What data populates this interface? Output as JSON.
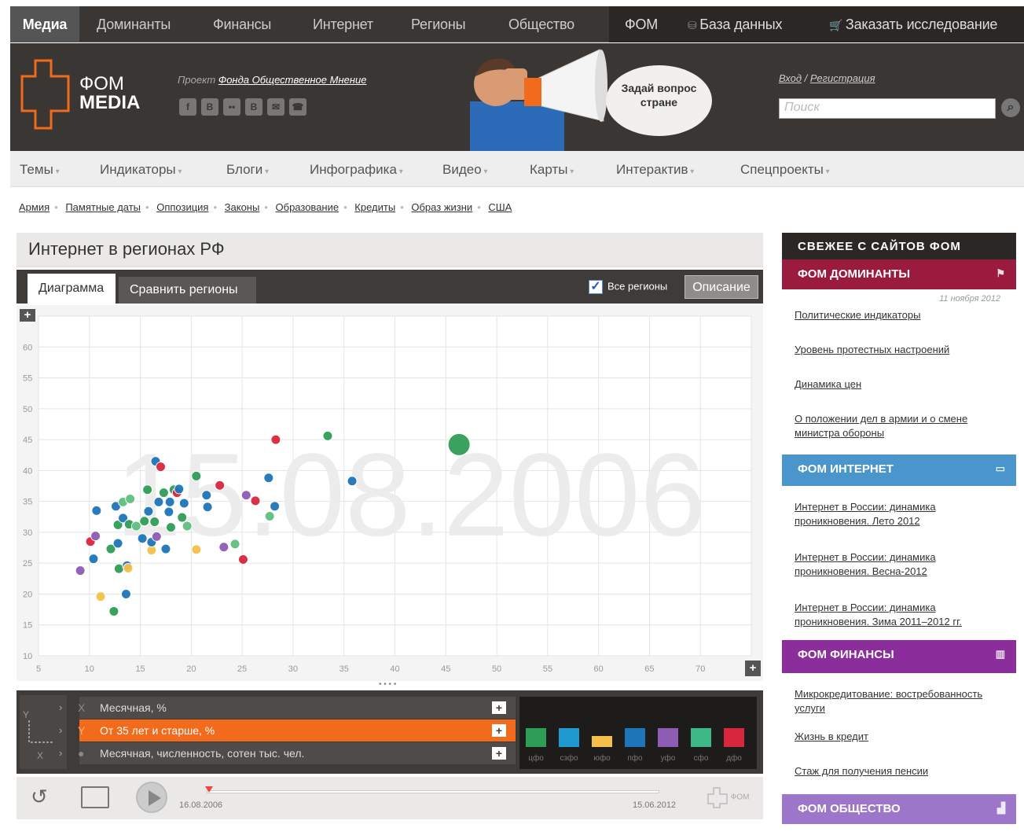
{
  "topnav": {
    "media": "Медиа",
    "items": [
      "Доминанты",
      "Финансы",
      "Интернет",
      "Регионы",
      "Общество"
    ],
    "fom": "ФОМ",
    "db": "База данных",
    "order": "Заказать исследование"
  },
  "header": {
    "logo_line1": "ФОМ",
    "logo_line2": "MEDIA",
    "project_prefix": "Проект",
    "project_link": "Фонда Общественное Мнение",
    "socials": [
      "f",
      "B",
      "••",
      "B",
      "✉",
      "☎"
    ],
    "bubble": "Задай вопрос стране",
    "login": "Вход",
    "login_sep": "/",
    "register": "Регистрация",
    "search_placeholder": "Поиск"
  },
  "mainnav": [
    "Темы",
    "Индикаторы",
    "Блоги",
    "Инфографика",
    "Видео",
    "Карты",
    "Интерактив",
    "Спецпроекты"
  ],
  "tags": [
    "Армия",
    "Памятные даты",
    "Оппозиция",
    "Законы",
    "Образование",
    "Кредиты",
    "Образ жизни",
    "США"
  ],
  "panel": {
    "title": "Интернет в регионах РФ",
    "tab_chart": "Диаграмма",
    "tab_compare": "Сравнить регионы",
    "all_regions": "Все регионы",
    "description": "Описание"
  },
  "chart_data": {
    "type": "scatter",
    "watermark": "15.08.2006",
    "xlim": [
      5,
      75
    ],
    "ylim": [
      10,
      65
    ],
    "xticks": [
      5,
      10,
      15,
      20,
      25,
      30,
      35,
      40,
      45,
      50,
      55,
      60,
      65,
      70,
      75
    ],
    "yticks": [
      10,
      15,
      20,
      25,
      30,
      35,
      40,
      45,
      50,
      55,
      60,
      65
    ],
    "points": [
      {
        "x": 9.1,
        "y": 23.8,
        "c": "#8e5bb5",
        "r": 6
      },
      {
        "x": 10.1,
        "y": 28.5,
        "c": "#d7263d",
        "r": 6
      },
      {
        "x": 10.6,
        "y": 29.4,
        "c": "#8e5bb5",
        "r": 6
      },
      {
        "x": 10.4,
        "y": 25.7,
        "c": "#1e76b8",
        "r": 6
      },
      {
        "x": 10.7,
        "y": 33.5,
        "c": "#1e76b8",
        "r": 6
      },
      {
        "x": 11.1,
        "y": 19.6,
        "c": "#f5c04a",
        "r": 6
      },
      {
        "x": 12.1,
        "y": 27.3,
        "c": "#2e9e56",
        "r": 6
      },
      {
        "x": 12.4,
        "y": 17.2,
        "c": "#2e9e56",
        "r": 6
      },
      {
        "x": 12.6,
        "y": 34.2,
        "c": "#1e76b8",
        "r": 6
      },
      {
        "x": 12.8,
        "y": 31.2,
        "c": "#2e9e56",
        "r": 6
      },
      {
        "x": 12.8,
        "y": 28.2,
        "c": "#1e76b8",
        "r": 6
      },
      {
        "x": 12.9,
        "y": 24.1,
        "c": "#2e9e56",
        "r": 6
      },
      {
        "x": 13.3,
        "y": 34.9,
        "c": "#5fbf7f",
        "r": 6
      },
      {
        "x": 13.3,
        "y": 32.3,
        "c": "#1e76b8",
        "r": 6
      },
      {
        "x": 13.6,
        "y": 20.0,
        "c": "#1e76b8",
        "r": 6
      },
      {
        "x": 13.7,
        "y": 24.6,
        "c": "#1e76b8",
        "r": 6
      },
      {
        "x": 13.8,
        "y": 24.2,
        "c": "#f5c04a",
        "r": 6
      },
      {
        "x": 13.9,
        "y": 31.3,
        "c": "#2e9e56",
        "r": 6
      },
      {
        "x": 14.0,
        "y": 35.4,
        "c": "#5fbf7f",
        "r": 6
      },
      {
        "x": 14.6,
        "y": 31.0,
        "c": "#5fbf7f",
        "r": 6
      },
      {
        "x": 15.4,
        "y": 31.8,
        "c": "#2e9e56",
        "r": 6
      },
      {
        "x": 15.2,
        "y": 29.0,
        "c": "#1e76b8",
        "r": 6
      },
      {
        "x": 15.7,
        "y": 36.9,
        "c": "#2e9e56",
        "r": 6
      },
      {
        "x": 15.8,
        "y": 33.4,
        "c": "#1e76b8",
        "r": 6
      },
      {
        "x": 16.1,
        "y": 27.1,
        "c": "#f5c04a",
        "r": 6
      },
      {
        "x": 16.1,
        "y": 28.4,
        "c": "#1e76b8",
        "r": 6
      },
      {
        "x": 16.4,
        "y": 31.7,
        "c": "#2e9e56",
        "r": 6
      },
      {
        "x": 16.6,
        "y": 29.3,
        "c": "#8e5bb5",
        "r": 6
      },
      {
        "x": 16.5,
        "y": 41.5,
        "c": "#1e76b8",
        "r": 6
      },
      {
        "x": 16.8,
        "y": 34.9,
        "c": "#1e76b8",
        "r": 6
      },
      {
        "x": 17.0,
        "y": 40.6,
        "c": "#d7263d",
        "r": 6
      },
      {
        "x": 17.3,
        "y": 36.4,
        "c": "#2e9e56",
        "r": 6
      },
      {
        "x": 17.5,
        "y": 27.3,
        "c": "#1e76b8",
        "r": 6
      },
      {
        "x": 17.8,
        "y": 33.3,
        "c": "#1e76b8",
        "r": 6
      },
      {
        "x": 17.9,
        "y": 34.9,
        "c": "#1e76b8",
        "r": 6
      },
      {
        "x": 18.0,
        "y": 30.8,
        "c": "#2e9e56",
        "r": 6
      },
      {
        "x": 18.3,
        "y": 36.9,
        "c": "#2e9e56",
        "r": 6
      },
      {
        "x": 18.6,
        "y": 36.4,
        "c": "#d7263d",
        "r": 6
      },
      {
        "x": 18.8,
        "y": 37.0,
        "c": "#1e76b8",
        "r": 6
      },
      {
        "x": 19.1,
        "y": 32.4,
        "c": "#2e9e56",
        "r": 6
      },
      {
        "x": 19.3,
        "y": 34.7,
        "c": "#1e76b8",
        "r": 6
      },
      {
        "x": 19.6,
        "y": 31.0,
        "c": "#5fbf7f",
        "r": 6
      },
      {
        "x": 20.5,
        "y": 39.1,
        "c": "#2e9e56",
        "r": 6
      },
      {
        "x": 20.5,
        "y": 27.2,
        "c": "#f5c04a",
        "r": 6
      },
      {
        "x": 21.5,
        "y": 36.0,
        "c": "#1e76b8",
        "r": 6
      },
      {
        "x": 21.6,
        "y": 34.1,
        "c": "#1e76b8",
        "r": 6
      },
      {
        "x": 22.8,
        "y": 37.6,
        "c": "#d7263d",
        "r": 6
      },
      {
        "x": 23.2,
        "y": 27.6,
        "c": "#8e5bb5",
        "r": 6
      },
      {
        "x": 24.3,
        "y": 28.1,
        "c": "#5fbf7f",
        "r": 6
      },
      {
        "x": 25.1,
        "y": 25.6,
        "c": "#d7263d",
        "r": 6
      },
      {
        "x": 25.4,
        "y": 36.0,
        "c": "#8e5bb5",
        "r": 6
      },
      {
        "x": 26.3,
        "y": 35.1,
        "c": "#d7263d",
        "r": 6
      },
      {
        "x": 27.6,
        "y": 38.8,
        "c": "#1e76b8",
        "r": 6
      },
      {
        "x": 27.7,
        "y": 32.6,
        "c": "#5fbf7f",
        "r": 6
      },
      {
        "x": 28.2,
        "y": 34.2,
        "c": "#1e76b8",
        "r": 6
      },
      {
        "x": 28.3,
        "y": 45.0,
        "c": "#d7263d",
        "r": 6
      },
      {
        "x": 33.4,
        "y": 45.6,
        "c": "#2e9e56",
        "r": 6
      },
      {
        "x": 35.8,
        "y": 38.3,
        "c": "#1e76b8",
        "r": 6
      },
      {
        "x": 46.3,
        "y": 44.2,
        "c": "#2e9e56",
        "r": 14
      }
    ]
  },
  "controls": {
    "axis_y": "Y",
    "axis_x": "X",
    "rows": [
      {
        "icon": "X",
        "label": "Месячная, %"
      },
      {
        "icon": "Y",
        "label": "От 35 лет и старше, %"
      },
      {
        "icon": "●",
        "label": "Месячная, численность, сотен тыс. чел."
      }
    ],
    "legend": [
      {
        "color": "#2e9e56",
        "label": "цфо"
      },
      {
        "color": "#1e9ad1",
        "label": "сзфо"
      },
      {
        "color": "#f5c04a",
        "label": "юфо"
      },
      {
        "color": "#1e76b8",
        "label": "пфо"
      },
      {
        "color": "#8e5bb5",
        "label": "уфо"
      },
      {
        "color": "#3fb888",
        "label": "сфо"
      },
      {
        "color": "#d7263d",
        "label": "дфо"
      }
    ]
  },
  "player": {
    "date_start": "16.08.2006",
    "date_end": "15.06.2012",
    "brand": "ФОМ"
  },
  "sidebar": {
    "heading": "СВЕЖЕЕ С САЙТОВ ФОМ",
    "sec1": "ФОМ ДОМИНАНТЫ",
    "sec1_date": "11 ноября 2012",
    "sec1_links": [
      "Политические индикаторы",
      "Уровень протестных настроений",
      "Динамика цен",
      "О положении дел в армии и о смене министра обороны"
    ],
    "sec2": "ФОМ ИНТЕРНЕТ",
    "sec2_links": [
      "Интернет в России: динамика проникновения. Лето 2012",
      "Интернет в России: динамика проникновения. Весна-2012",
      "Интернет в России: динамика проникновения. Зима 2011–2012 гг."
    ],
    "sec3": "ФОМ ФИНАНСЫ",
    "sec3_links": [
      "Микрокредитование: востребованность услуги",
      "Жизнь в кредит",
      "Стаж для получения пенсии"
    ],
    "sec4": "ФОМ ОБЩЕСТВО"
  },
  "colors": {
    "accent": "#f26a1b",
    "dominanty": "#9b1b3e",
    "internet": "#4a96cc",
    "finansy": "#8b2d9a",
    "obshestvo": "#9c77c9"
  }
}
